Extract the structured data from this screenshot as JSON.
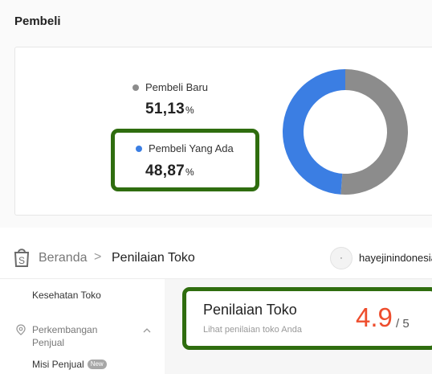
{
  "buyers": {
    "section_title": "Pembeli",
    "new_label": "Pembeli Baru",
    "new_value": "51,13",
    "existing_label": "Pembeli Yang Ada",
    "existing_value": "48,87",
    "percent_sign": "%",
    "colors": {
      "new": "#8c8c8c",
      "existing": "#3b7ee3"
    }
  },
  "chart_data": {
    "type": "pie",
    "categories": [
      "Pembeli Baru",
      "Pembeli Yang Ada"
    ],
    "values": [
      51.13,
      48.87
    ],
    "colors": [
      "#8c8c8c",
      "#3b7ee3"
    ],
    "donut": true
  },
  "seller": {
    "breadcrumb_home": "Beranda",
    "breadcrumb_sep": ">",
    "breadcrumb_current": "Penilaian Toko",
    "shop_name": "hayejinindonesia",
    "sidebar": {
      "health": "Kesehatan Toko",
      "growth_group": "Perkembangan Penjual",
      "missions": "Misi Penjual",
      "new_badge": "New"
    },
    "rating": {
      "title": "Penilaian Toko",
      "subtitle": "Lihat penilaian toko Anda",
      "score": "4.9",
      "max": "/ 5"
    }
  },
  "highlight_color": "#2f6d0f"
}
